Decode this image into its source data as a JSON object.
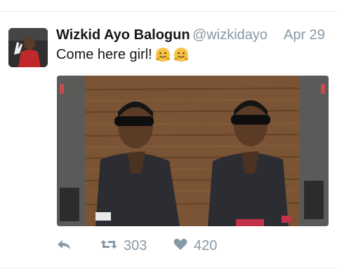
{
  "tweet": {
    "display_name": "Wizkid Ayo Balogun",
    "handle": "@wizkidayo",
    "date": "Apr 29",
    "text": "Come here girl!",
    "emojis": [
      "hugging-face-emoji",
      "hugging-face-emoji"
    ]
  },
  "actions": {
    "retweet_count": "303",
    "like_count": "420"
  },
  "icons": {
    "reply": "reply-icon",
    "retweet": "retweet-icon",
    "like": "heart-icon"
  },
  "colors": {
    "name": "#14171a",
    "secondary": "#8899a6",
    "divider": "#e6ecf0"
  }
}
